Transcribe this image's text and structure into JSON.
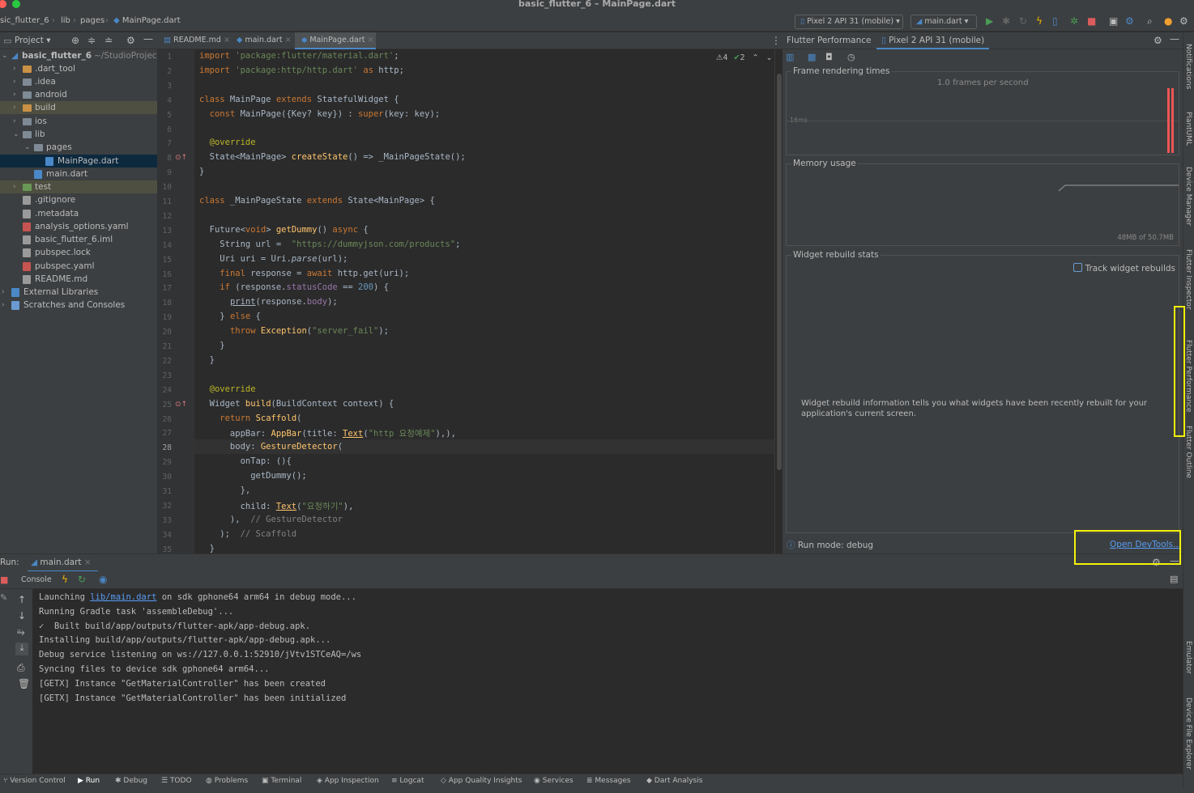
{
  "window": {
    "title": "basic_flutter_6 – MainPage.dart"
  },
  "breadcrumbs": [
    "sic_flutter_6",
    "lib",
    "pages",
    "MainPage.dart"
  ],
  "toolbar": {
    "device": "Pixel 2 API 31 (mobile)",
    "run_config": "main.dart"
  },
  "project": {
    "header": "Project",
    "root_name": "basic_flutter_6",
    "root_path": "~/StudioProject",
    "items": [
      {
        "label": ".dart_tool",
        "kind": "folder-orange"
      },
      {
        "label": ".idea",
        "kind": "folder"
      },
      {
        "label": "android",
        "kind": "folder"
      },
      {
        "label": "build",
        "kind": "folder-orange"
      },
      {
        "label": "ios",
        "kind": "folder"
      },
      {
        "label": "lib",
        "kind": "folder"
      },
      {
        "label": "pages",
        "kind": "folder"
      },
      {
        "label": "MainPage.dart",
        "kind": "dart"
      },
      {
        "label": "main.dart",
        "kind": "dart"
      },
      {
        "label": "test",
        "kind": "folder-test"
      },
      {
        "label": ".gitignore",
        "kind": "file"
      },
      {
        "label": ".metadata",
        "kind": "file"
      },
      {
        "label": "analysis_options.yaml",
        "kind": "yaml"
      },
      {
        "label": "basic_flutter_6.iml",
        "kind": "file"
      },
      {
        "label": "pubspec.lock",
        "kind": "file"
      },
      {
        "label": "pubspec.yaml",
        "kind": "yaml"
      },
      {
        "label": "README.md",
        "kind": "file"
      },
      {
        "label": "External Libraries",
        "kind": "lib"
      },
      {
        "label": "Scratches and Consoles",
        "kind": "scratch"
      }
    ]
  },
  "editor": {
    "tabs": [
      "README.md",
      "main.dart",
      "MainPage.dart"
    ],
    "warnings": "4",
    "checks": "2",
    "current_line": "28"
  },
  "perf": {
    "tool_title": "Flutter Performance",
    "device_tab": "Pixel 2 API 31 (mobile)",
    "frame_title": "Frame rendering times",
    "fps": "1.0 frames per second",
    "ms_label": "16ms",
    "memory_title": "Memory usage",
    "memory_value": "48MB of 50.7MB",
    "rebuild_title": "Widget rebuild stats",
    "track_label": "Track widget rebuilds",
    "rebuild_info": "Widget rebuild information tells you what widgets have been recently rebuilt for your application's current screen.",
    "run_mode": "Run mode: debug",
    "devtools_link": "Open DevTools..."
  },
  "right_tabs": [
    "Notifications",
    "PlantUML",
    "Device Manager",
    "Flutter Inspector",
    "Flutter Performance",
    "Flutter Outline",
    "Emulator",
    "Device File Explorer"
  ],
  "run": {
    "label": "Run:",
    "tab": "main.dart",
    "console_tab": "Console",
    "lines": [
      {
        "prefix": "Launching ",
        "link": "lib/main.dart",
        "suffix": " on sdk gphone64 arm64 in debug mode..."
      },
      {
        "prefix": "Running Gradle task 'assembleDebug'...",
        "link": "",
        "suffix": ""
      },
      {
        "prefix": "✓  Built build/app/outputs/flutter-apk/app-debug.apk.",
        "link": "",
        "suffix": ""
      },
      {
        "prefix": "Installing build/app/outputs/flutter-apk/app-debug.apk...",
        "link": "",
        "suffix": ""
      },
      {
        "prefix": "Debug service listening on ws://127.0.0.1:52910/jVtv1STCeAQ=/ws",
        "link": "",
        "suffix": ""
      },
      {
        "prefix": "Syncing files to device sdk gphone64 arm64...",
        "link": "",
        "suffix": ""
      },
      {
        "prefix": "[GETX] Instance \"GetMaterialController\" has been created",
        "link": "",
        "suffix": ""
      },
      {
        "prefix": "[GETX] Instance \"GetMaterialController\" has been initialized",
        "link": "",
        "suffix": ""
      }
    ]
  },
  "bottom_tools": [
    "Version Control",
    "Run",
    "Debug",
    "TODO",
    "Problems",
    "Terminal",
    "App Inspection",
    "Logcat",
    "App Quality Insights",
    "Services",
    "Messages",
    "Dart Analysis"
  ],
  "colors": {
    "accent": "#4a88c7",
    "highlight": "#f2f20a",
    "run_green": "#499c54"
  }
}
